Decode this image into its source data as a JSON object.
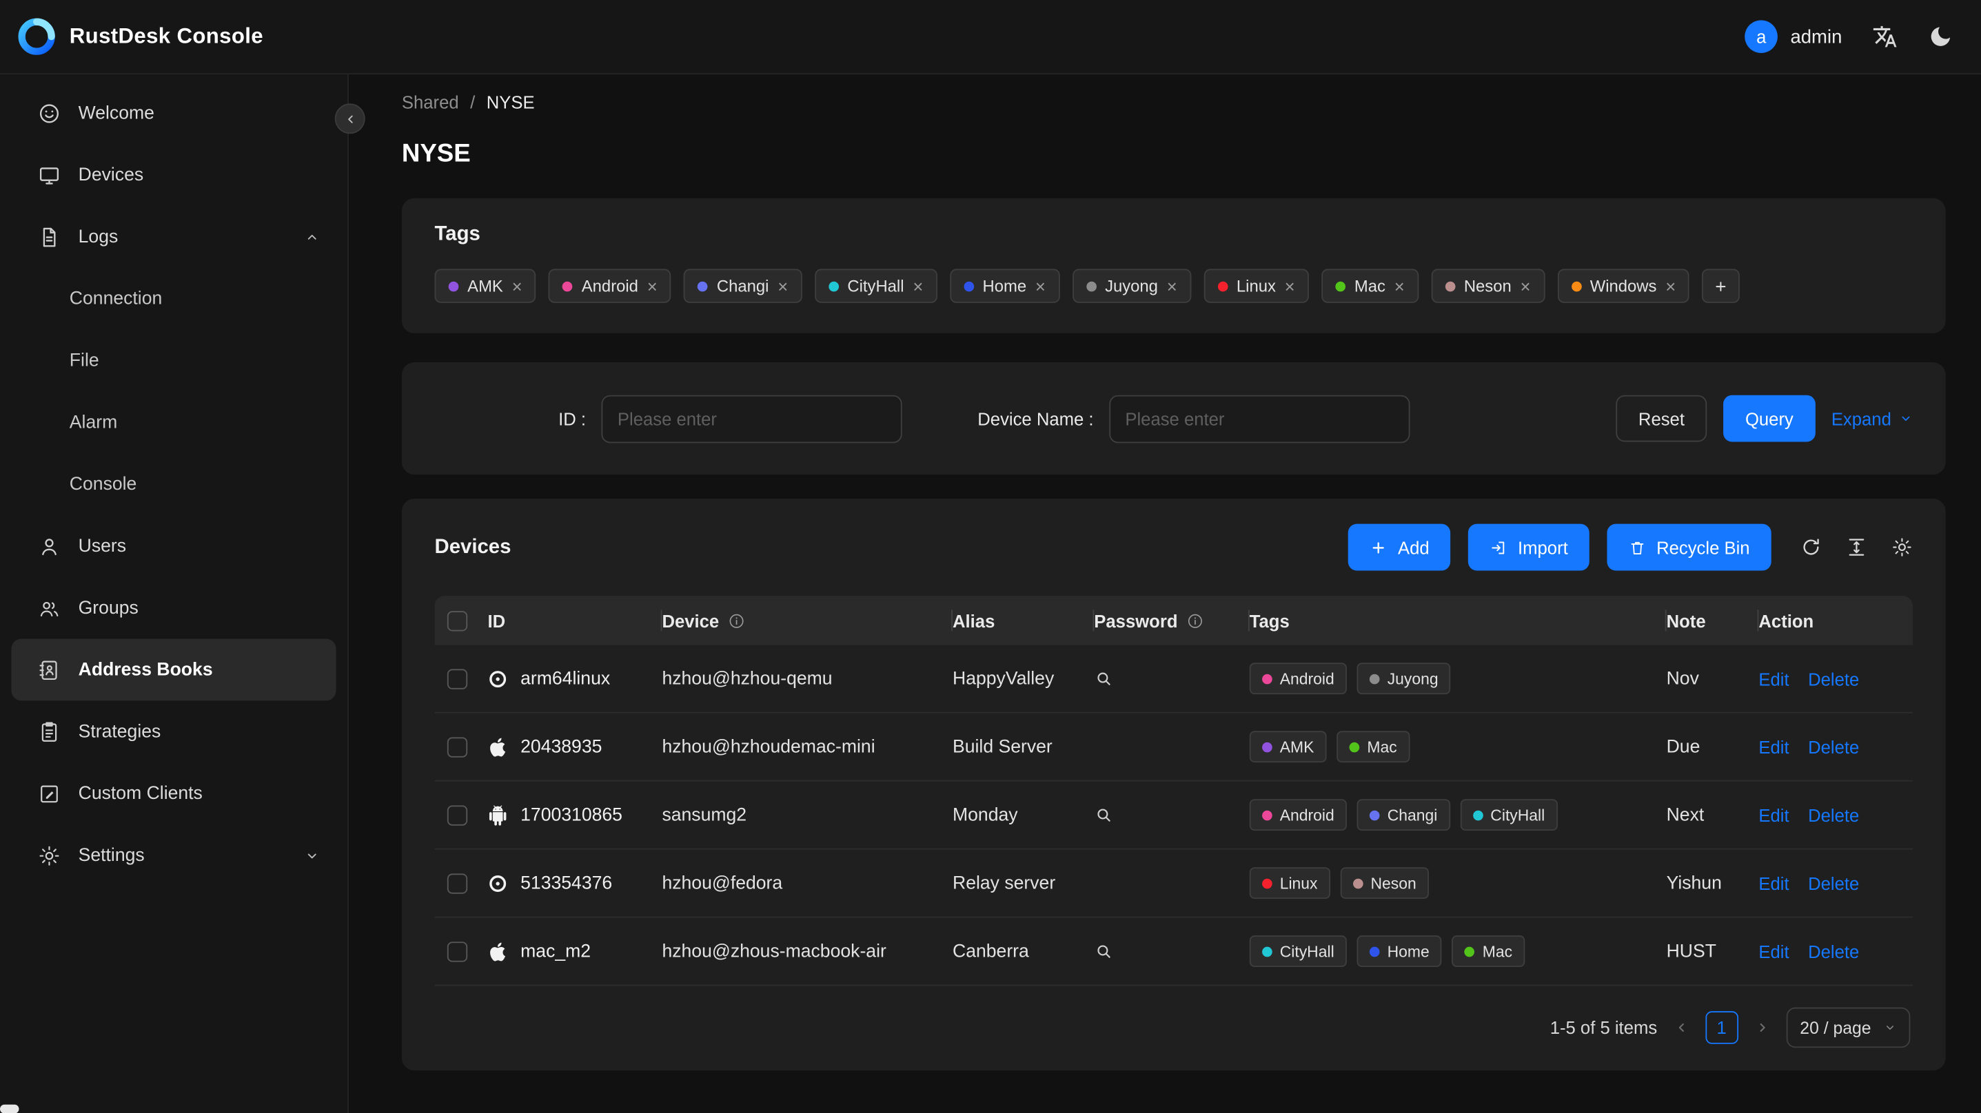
{
  "header": {
    "app_title": "RustDesk Console",
    "user": {
      "avatar_letter": "a",
      "name": "admin"
    }
  },
  "icons": {
    "tag_close": "×"
  },
  "sidebar": {
    "items": [
      {
        "label": "Welcome"
      },
      {
        "label": "Devices"
      },
      {
        "label": "Logs"
      },
      {
        "label": "Connection"
      },
      {
        "label": "File"
      },
      {
        "label": "Alarm"
      },
      {
        "label": "Console"
      },
      {
        "label": "Users"
      },
      {
        "label": "Groups"
      },
      {
        "label": "Address Books"
      },
      {
        "label": "Strategies"
      },
      {
        "label": "Custom Clients"
      },
      {
        "label": "Settings"
      }
    ]
  },
  "breadcrumb": {
    "parent": "Shared",
    "separator": "/",
    "current": "NYSE"
  },
  "page_title": "NYSE",
  "accent_color": "#1677ff",
  "tags_card": {
    "title": "Tags",
    "tags": [
      {
        "label": "AMK",
        "color": "#9254de"
      },
      {
        "label": "Android",
        "color": "#ec4899"
      },
      {
        "label": "Changi",
        "color": "#6672f0"
      },
      {
        "label": "CityHall",
        "color": "#22c7d6"
      },
      {
        "label": "Home",
        "color": "#2f54eb"
      },
      {
        "label": "Juyong",
        "color": "#8c8c8c"
      },
      {
        "label": "Linux",
        "color": "#f5222d"
      },
      {
        "label": "Mac",
        "color": "#52c41a"
      },
      {
        "label": "Neson",
        "color": "#bc8f8f"
      },
      {
        "label": "Windows",
        "color": "#fa8c16"
      }
    ]
  },
  "filter": {
    "id_label": "ID :",
    "id_placeholder": "Please enter",
    "device_label": "Device Name :",
    "device_placeholder": "Please enter",
    "reset": "Reset",
    "query": "Query",
    "expand": "Expand"
  },
  "devices": {
    "title": "Devices",
    "buttons": {
      "add": "Add",
      "import": "Import",
      "recycle_bin": "Recycle Bin"
    },
    "columns": {
      "id": "ID",
      "device": "Device",
      "alias": "Alias",
      "password": "Password",
      "tags": "Tags",
      "note": "Note",
      "action": "Action"
    },
    "row_actions": {
      "edit": "Edit",
      "delete": "Delete"
    },
    "rows": [
      {
        "os": "linux",
        "id": "arm64linux",
        "device": "hzhou@hzhou-qemu",
        "alias": "HappyValley",
        "password_searchable": true,
        "tags": [
          {
            "label": "Android",
            "color": "#ec4899"
          },
          {
            "label": "Juyong",
            "color": "#8c8c8c"
          }
        ],
        "note": "Nov"
      },
      {
        "os": "mac",
        "id": "20438935",
        "device": "hzhou@hzhoudemac-mini",
        "alias": "Build Server",
        "password_searchable": false,
        "tags": [
          {
            "label": "AMK",
            "color": "#9254de"
          },
          {
            "label": "Mac",
            "color": "#52c41a"
          }
        ],
        "note": "Due"
      },
      {
        "os": "android",
        "id": "1700310865",
        "device": "sansumg2",
        "alias": "Monday",
        "password_searchable": true,
        "tags": [
          {
            "label": "Android",
            "color": "#ec4899"
          },
          {
            "label": "Changi",
            "color": "#6672f0"
          },
          {
            "label": "CityHall",
            "color": "#22c7d6"
          }
        ],
        "note": "Next"
      },
      {
        "os": "linux",
        "id": "513354376",
        "device": "hzhou@fedora",
        "alias": "Relay server",
        "password_searchable": false,
        "tags": [
          {
            "label": "Linux",
            "color": "#f5222d"
          },
          {
            "label": "Neson",
            "color": "#bc8f8f"
          }
        ],
        "note": "Yishun"
      },
      {
        "os": "mac",
        "id": "mac_m2",
        "device": "hzhou@zhous-macbook-air",
        "alias": "Canberra",
        "password_searchable": true,
        "tags": [
          {
            "label": "CityHall",
            "color": "#22c7d6"
          },
          {
            "label": "Home",
            "color": "#2f54eb"
          },
          {
            "label": "Mac",
            "color": "#52c41a"
          }
        ],
        "note": "HUST"
      }
    ],
    "pagination": {
      "summary": "1-5 of 5 items",
      "current_page": "1",
      "page_size": "20 / page"
    }
  }
}
